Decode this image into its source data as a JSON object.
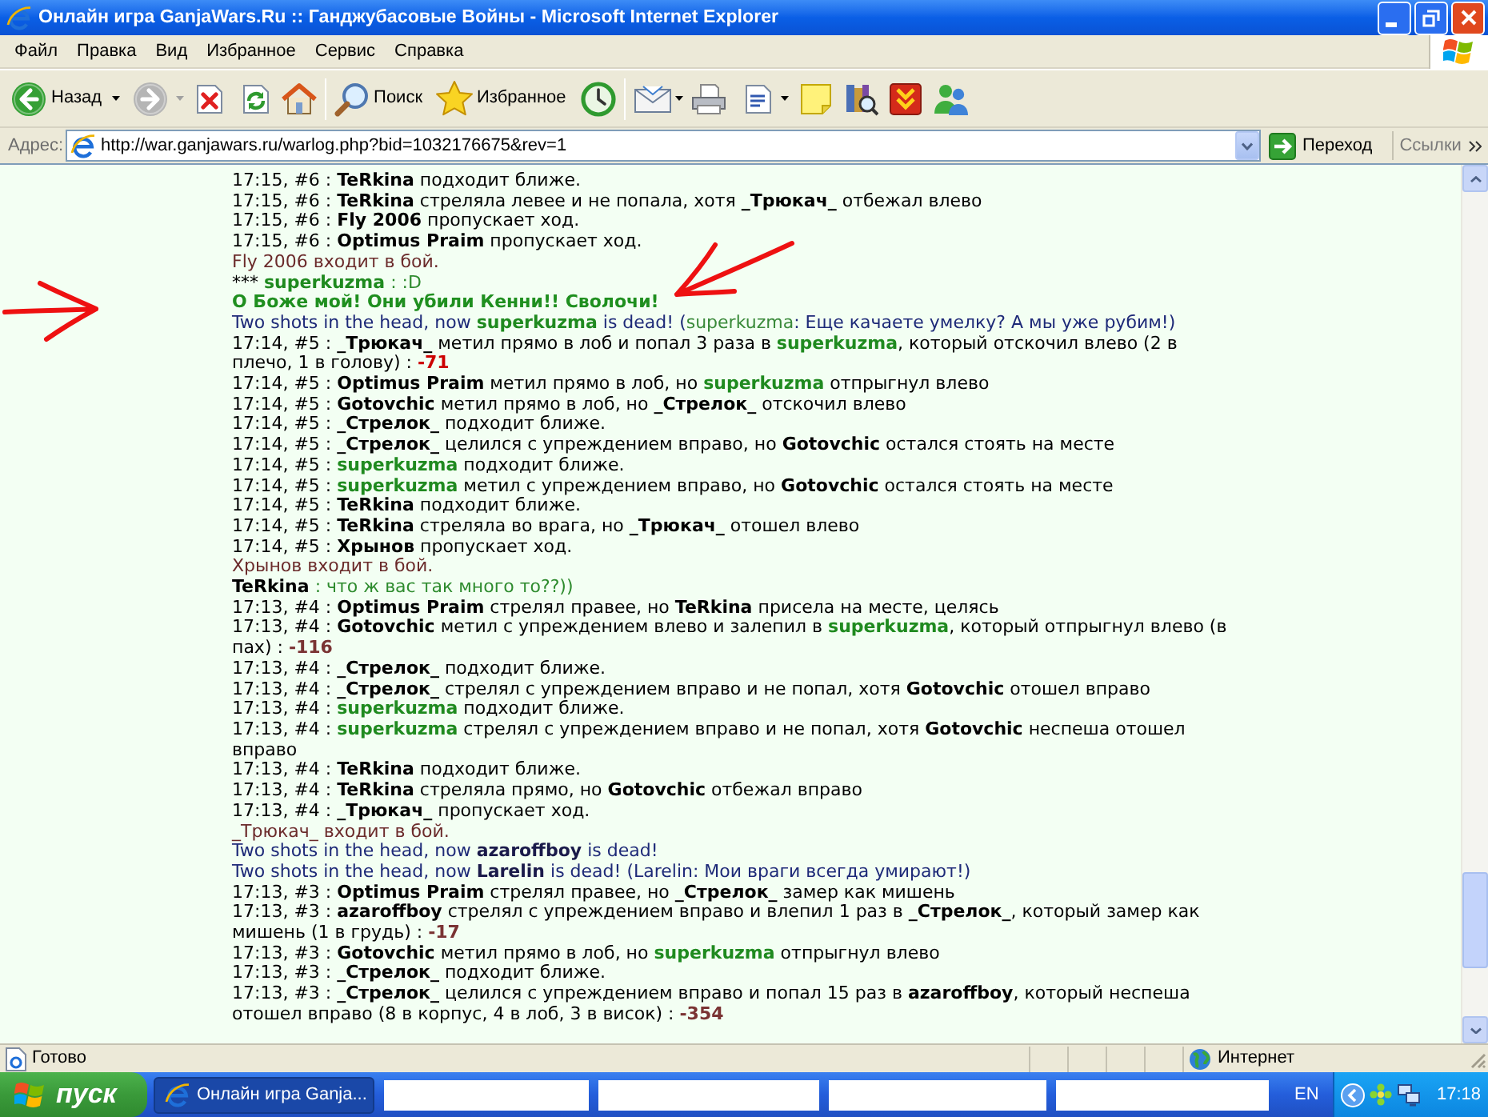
{
  "window": {
    "title": "Онлайн игра GanjaWars.Ru :: Ганджубасовые Войны - Microsoft Internet Explorer"
  },
  "menu": [
    "Файл",
    "Правка",
    "Вид",
    "Избранное",
    "Сервис",
    "Справка"
  ],
  "toolbar": {
    "back": {
      "label": "Назад",
      "disabled": false
    },
    "forward": {
      "disabled": true
    },
    "search": {
      "label": "Поиск"
    },
    "favorites": {
      "label": "Избранное"
    }
  },
  "address_bar": {
    "label": "Адрес:",
    "url": "http://war.ganjawars.ru/warlog.php?bid=1032176675&rev=1",
    "go": "Переход",
    "links": "Ссылки"
  },
  "log": [
    {
      "kind": "turn",
      "parts": [
        {
          "kind": "plain",
          "text": "17:15, #6 : "
        },
        {
          "kind": "name",
          "text": "TeRkina",
          "color": "#000000"
        },
        {
          "kind": "plain",
          "text": " подходит ближе."
        }
      ]
    },
    {
      "kind": "turn",
      "parts": [
        {
          "kind": "plain",
          "text": "17:15, #6 : "
        },
        {
          "kind": "name",
          "text": "TeRkina",
          "color": "#000000"
        },
        {
          "kind": "plain",
          "text": " стреляла левее и не попала, хотя "
        },
        {
          "kind": "name",
          "text": "_Трюкач_",
          "color": "#000000"
        },
        {
          "kind": "plain",
          "text": " отбежал влево"
        }
      ]
    },
    {
      "kind": "turn",
      "parts": [
        {
          "kind": "plain",
          "text": "17:15, #6 : "
        },
        {
          "kind": "name",
          "text": "Fly 2006",
          "color": "#000000"
        },
        {
          "kind": "plain",
          "text": " пропускает ход."
        }
      ]
    },
    {
      "kind": "turn",
      "parts": [
        {
          "kind": "plain",
          "text": "17:15, #6 : "
        },
        {
          "kind": "name",
          "text": "Optimus Praim",
          "color": "#000000"
        },
        {
          "kind": "plain",
          "text": " пропускает ход."
        }
      ]
    },
    {
      "kind": "join",
      "parts": [
        {
          "kind": "plain",
          "text": "Fly 2006 входит в бой."
        }
      ]
    },
    {
      "kind": "chat",
      "parts": [
        {
          "kind": "plain",
          "text": "*** ",
          "color": "#000000"
        },
        {
          "kind": "name",
          "text": "superkuzma",
          "color": "#1f8a1f"
        },
        {
          "kind": "plain",
          "text": " : :D"
        }
      ]
    },
    {
      "kind": "shout",
      "parts": [
        {
          "kind": "plain",
          "text": "О Боже мой! Они убили Кенни!! Сволочи!"
        }
      ]
    },
    {
      "kind": "death",
      "parts": [
        {
          "kind": "plain",
          "text": "Two shots in the head, now "
        },
        {
          "kind": "name",
          "text": "superkuzma",
          "color": "#1f8a1f"
        },
        {
          "kind": "plain",
          "text": " is dead! ("
        },
        {
          "kind": "plain",
          "text": "superkuzma",
          "color": "#3a8a3a"
        },
        {
          "kind": "plain",
          "text": ": Еще качаете умелку? А мы уже рубим!)"
        }
      ]
    },
    {
      "kind": "turn",
      "parts": [
        {
          "kind": "plain",
          "text": "17:14, #5 : "
        },
        {
          "kind": "name",
          "text": "_Трюкач_",
          "color": "#000000"
        },
        {
          "kind": "plain",
          "text": " метил прямо в лоб и попал 3 раза в "
        },
        {
          "kind": "name",
          "text": "superkuzma",
          "color": "#1f8a1f"
        },
        {
          "kind": "plain",
          "text": ", который отскочил влево (2 в плечо, 1 в голову) : "
        },
        {
          "kind": "damage",
          "text": "-71",
          "color": "#cc0000"
        }
      ]
    },
    {
      "kind": "turn",
      "parts": [
        {
          "kind": "plain",
          "text": "17:14, #5 : "
        },
        {
          "kind": "name",
          "text": "Optimus Praim",
          "color": "#000000"
        },
        {
          "kind": "plain",
          "text": " метил прямо в лоб, но "
        },
        {
          "kind": "name",
          "text": "superkuzma",
          "color": "#1f8a1f"
        },
        {
          "kind": "plain",
          "text": " отпрыгнул влево"
        }
      ]
    },
    {
      "kind": "turn",
      "parts": [
        {
          "kind": "plain",
          "text": "17:14, #5 : "
        },
        {
          "kind": "name",
          "text": "Gotovchic",
          "color": "#000000"
        },
        {
          "kind": "plain",
          "text": " метил прямо в лоб, но "
        },
        {
          "kind": "name",
          "text": "_Стрелок_",
          "color": "#000000"
        },
        {
          "kind": "plain",
          "text": " отскочил влево"
        }
      ]
    },
    {
      "kind": "turn",
      "parts": [
        {
          "kind": "plain",
          "text": "17:14, #5 : "
        },
        {
          "kind": "name",
          "text": "_Стрелок_",
          "color": "#000000"
        },
        {
          "kind": "plain",
          "text": " подходит ближе."
        }
      ]
    },
    {
      "kind": "turn",
      "parts": [
        {
          "kind": "plain",
          "text": "17:14, #5 : "
        },
        {
          "kind": "name",
          "text": "_Стрелок_",
          "color": "#000000"
        },
        {
          "kind": "plain",
          "text": " целился с упреждением вправо, но "
        },
        {
          "kind": "name",
          "text": "Gotovchic",
          "color": "#000000"
        },
        {
          "kind": "plain",
          "text": " остался стоять на месте"
        }
      ]
    },
    {
      "kind": "turn",
      "parts": [
        {
          "kind": "plain",
          "text": "17:14, #5 : "
        },
        {
          "kind": "name",
          "text": "superkuzma",
          "color": "#1f8a1f"
        },
        {
          "kind": "plain",
          "text": " подходит ближе."
        }
      ]
    },
    {
      "kind": "turn",
      "parts": [
        {
          "kind": "plain",
          "text": "17:14, #5 : "
        },
        {
          "kind": "name",
          "text": "superkuzma",
          "color": "#1f8a1f"
        },
        {
          "kind": "plain",
          "text": " метил с упреждением вправо, но "
        },
        {
          "kind": "name",
          "text": "Gotovchic",
          "color": "#000000"
        },
        {
          "kind": "plain",
          "text": " остался стоять на месте"
        }
      ]
    },
    {
      "kind": "turn",
      "parts": [
        {
          "kind": "plain",
          "text": "17:14, #5 : "
        },
        {
          "kind": "name",
          "text": "TeRkina",
          "color": "#000000"
        },
        {
          "kind": "plain",
          "text": " подходит ближе."
        }
      ]
    },
    {
      "kind": "turn",
      "parts": [
        {
          "kind": "plain",
          "text": "17:14, #5 : "
        },
        {
          "kind": "name",
          "text": "TeRkina",
          "color": "#000000"
        },
        {
          "kind": "plain",
          "text": " стреляла во врага, но "
        },
        {
          "kind": "name",
          "text": "_Трюкач_",
          "color": "#000000"
        },
        {
          "kind": "plain",
          "text": " отошел влево"
        }
      ]
    },
    {
      "kind": "turn",
      "parts": [
        {
          "kind": "plain",
          "text": "17:14, #5 : "
        },
        {
          "kind": "name",
          "text": "Хрынов",
          "color": "#000000"
        },
        {
          "kind": "plain",
          "text": " пропускает ход."
        }
      ]
    },
    {
      "kind": "join",
      "parts": [
        {
          "kind": "plain",
          "text": "Хрынов входит в бой."
        }
      ]
    },
    {
      "kind": "chat",
      "parts": [
        {
          "kind": "name",
          "text": "TeRkina",
          "color": "#000000"
        },
        {
          "kind": "plain",
          "text": " : что ж вас так много то??))"
        }
      ]
    },
    {
      "kind": "turn",
      "parts": [
        {
          "kind": "plain",
          "text": "17:13, #4 : "
        },
        {
          "kind": "name",
          "text": "Optimus Praim",
          "color": "#000000"
        },
        {
          "kind": "plain",
          "text": " стрелял правее, но "
        },
        {
          "kind": "name",
          "text": "TeRkina",
          "color": "#000000"
        },
        {
          "kind": "plain",
          "text": " присела на месте, целясь"
        }
      ]
    },
    {
      "kind": "turn",
      "parts": [
        {
          "kind": "plain",
          "text": "17:13, #4 : "
        },
        {
          "kind": "name",
          "text": "Gotovchic",
          "color": "#000000"
        },
        {
          "kind": "plain",
          "text": " метил с упреждением влево и залепил в "
        },
        {
          "kind": "name",
          "text": "superkuzma",
          "color": "#1f8a1f"
        },
        {
          "kind": "plain",
          "text": ", который отпрыгнул влево (в пах) : "
        },
        {
          "kind": "damage",
          "text": "-116",
          "color": "#7a3333"
        }
      ]
    },
    {
      "kind": "turn",
      "parts": [
        {
          "kind": "plain",
          "text": "17:13, #4 : "
        },
        {
          "kind": "name",
          "text": "_Стрелок_",
          "color": "#000000"
        },
        {
          "kind": "plain",
          "text": " подходит ближе."
        }
      ]
    },
    {
      "kind": "turn",
      "parts": [
        {
          "kind": "plain",
          "text": "17:13, #4 : "
        },
        {
          "kind": "name",
          "text": "_Стрелок_",
          "color": "#000000"
        },
        {
          "kind": "plain",
          "text": " стрелял с упреждением вправо и не попал, хотя "
        },
        {
          "kind": "name",
          "text": "Gotovchic",
          "color": "#000000"
        },
        {
          "kind": "plain",
          "text": " отошел вправо"
        }
      ]
    },
    {
      "kind": "turn",
      "parts": [
        {
          "kind": "plain",
          "text": "17:13, #4 : "
        },
        {
          "kind": "name",
          "text": "superkuzma",
          "color": "#1f8a1f"
        },
        {
          "kind": "plain",
          "text": " подходит ближе."
        }
      ]
    },
    {
      "kind": "turn",
      "parts": [
        {
          "kind": "plain",
          "text": "17:13, #4 : "
        },
        {
          "kind": "name",
          "text": "superkuzma",
          "color": "#1f8a1f"
        },
        {
          "kind": "plain",
          "text": " стрелял с упреждением вправо и не попал, хотя "
        },
        {
          "kind": "name",
          "text": "Gotovchic",
          "color": "#000000"
        },
        {
          "kind": "plain",
          "text": " неспеша отошел вправо"
        }
      ]
    },
    {
      "kind": "turn",
      "parts": [
        {
          "kind": "plain",
          "text": "17:13, #4 : "
        },
        {
          "kind": "name",
          "text": "TeRkina",
          "color": "#000000"
        },
        {
          "kind": "plain",
          "text": " подходит ближе."
        }
      ]
    },
    {
      "kind": "turn",
      "parts": [
        {
          "kind": "plain",
          "text": "17:13, #4 : "
        },
        {
          "kind": "name",
          "text": "TeRkina",
          "color": "#000000"
        },
        {
          "kind": "plain",
          "text": " стреляла прямо, но "
        },
        {
          "kind": "name",
          "text": "Gotovchic",
          "color": "#000000"
        },
        {
          "kind": "plain",
          "text": " отбежал вправо"
        }
      ]
    },
    {
      "kind": "turn",
      "parts": [
        {
          "kind": "plain",
          "text": "17:13, #4 : "
        },
        {
          "kind": "name",
          "text": "_Трюкач_",
          "color": "#000000"
        },
        {
          "kind": "plain",
          "text": " пропускает ход."
        }
      ]
    },
    {
      "kind": "join",
      "parts": [
        {
          "kind": "plain",
          "text": "_Трюкач_ входит в бой."
        }
      ]
    },
    {
      "kind": "death",
      "parts": [
        {
          "kind": "plain",
          "text": "Two shots in the head, now "
        },
        {
          "kind": "name",
          "text": "azaroffboy",
          "color": "#1a1a4a"
        },
        {
          "kind": "plain",
          "text": " is dead!"
        }
      ]
    },
    {
      "kind": "death",
      "parts": [
        {
          "kind": "plain",
          "text": "Two shots in the head, now "
        },
        {
          "kind": "name",
          "text": "Larelin",
          "color": "#1a1a4a"
        },
        {
          "kind": "plain",
          "text": " is dead! (Larelin: Мои враги всегда умирают!)"
        }
      ]
    },
    {
      "kind": "turn",
      "parts": [
        {
          "kind": "plain",
          "text": "17:13, #3 : "
        },
        {
          "kind": "name",
          "text": "Optimus Praim",
          "color": "#000000"
        },
        {
          "kind": "plain",
          "text": " стрелял правее, но "
        },
        {
          "kind": "name",
          "text": "_Стрелок_",
          "color": "#000000"
        },
        {
          "kind": "plain",
          "text": " замер как мишень"
        }
      ]
    },
    {
      "kind": "turn",
      "parts": [
        {
          "kind": "plain",
          "text": "17:13, #3 : "
        },
        {
          "kind": "name",
          "text": "azaroffboy",
          "color": "#000000"
        },
        {
          "kind": "plain",
          "text": " стрелял с упреждением вправо и влепил 1 раз в "
        },
        {
          "kind": "name",
          "text": "_Стрелок_",
          "color": "#000000"
        },
        {
          "kind": "plain",
          "text": ", который замер как мишень (1 в грудь) : "
        },
        {
          "kind": "damage",
          "text": "-17",
          "color": "#7a3333"
        }
      ]
    },
    {
      "kind": "turn",
      "parts": [
        {
          "kind": "plain",
          "text": "17:13, #3 : "
        },
        {
          "kind": "name",
          "text": "Gotovchic",
          "color": "#000000"
        },
        {
          "kind": "plain",
          "text": " метил прямо в лоб, но "
        },
        {
          "kind": "name",
          "text": "superkuzma",
          "color": "#1f8a1f"
        },
        {
          "kind": "plain",
          "text": " отпрыгнул влево"
        }
      ]
    },
    {
      "kind": "turn",
      "parts": [
        {
          "kind": "plain",
          "text": "17:13, #3 : "
        },
        {
          "kind": "name",
          "text": "_Стрелок_",
          "color": "#000000"
        },
        {
          "kind": "plain",
          "text": " подходит ближе."
        }
      ]
    },
    {
      "kind": "turn",
      "parts": [
        {
          "kind": "plain",
          "text": "17:13, #3 : "
        },
        {
          "kind": "name",
          "text": "_Стрелок_",
          "color": "#000000"
        },
        {
          "kind": "plain",
          "text": " целился с упреждением вправо и попал 15 раз в "
        },
        {
          "kind": "name",
          "text": "azaroffboy",
          "color": "#000000"
        },
        {
          "kind": "plain",
          "text": ", который неспеша отошел вправо (8 в корпус, 4 в лоб, 3 в висок) : "
        },
        {
          "kind": "damage",
          "text": "-354",
          "color": "#7a3333"
        }
      ]
    }
  ],
  "status_bar": {
    "text": "Готово",
    "zone": "Интернет"
  },
  "taskbar": {
    "start": "пуск",
    "tasks": [
      {
        "label": "Онлайн игра Ganja...",
        "selected": true
      }
    ],
    "language": "EN",
    "clock": "17:18"
  }
}
